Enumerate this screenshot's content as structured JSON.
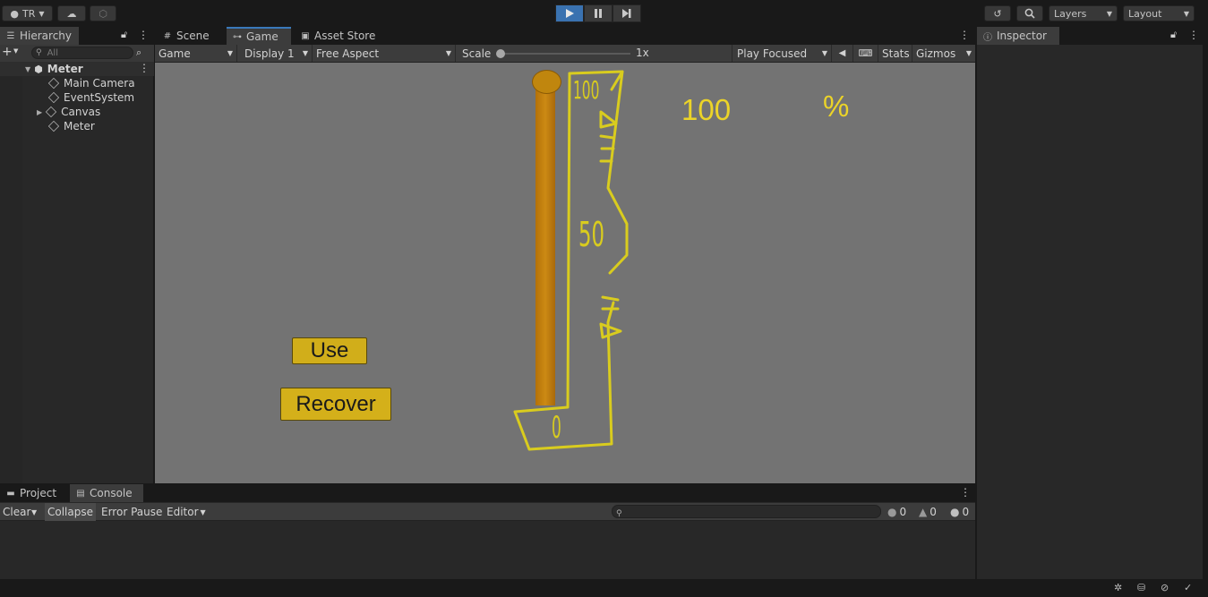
{
  "toolbar": {
    "account": "TR",
    "layers": "Layers",
    "layout": "Layout"
  },
  "hierarchy": {
    "tab": "Hierarchy",
    "search_placeholder": "All",
    "scene": "Meter",
    "items": [
      "Main Camera",
      "EventSystem",
      "Canvas",
      "Meter"
    ]
  },
  "center_tabs": [
    "Scene",
    "Game",
    "Asset Store"
  ],
  "game_toolbar": {
    "display_mode": "Game",
    "display": "Display 1",
    "aspect": "Free Aspect",
    "scale_label": "Scale",
    "scale_value": "1x",
    "play_mode": "Play Focused",
    "stats": "Stats",
    "gizmos": "Gizmos"
  },
  "game": {
    "value": "100",
    "percent": "%",
    "use_button": "Use",
    "recover_button": "Recover",
    "gauge_labels": [
      "100",
      "50",
      "0"
    ],
    "fill_fraction": 1.0
  },
  "inspector": {
    "tab": "Inspector"
  },
  "console": {
    "tabs": [
      "Project",
      "Console"
    ],
    "clear": "Clear",
    "collapse": "Collapse",
    "error_pause": "Error Pause",
    "editor": "Editor",
    "log_count": "0",
    "warn_count": "0",
    "error_count": "0"
  },
  "colors": {
    "accent": "#3a72b0",
    "gauge_outline": "#d9cc1e",
    "bar": "#c07d0c",
    "button": "#d1ae1a"
  }
}
